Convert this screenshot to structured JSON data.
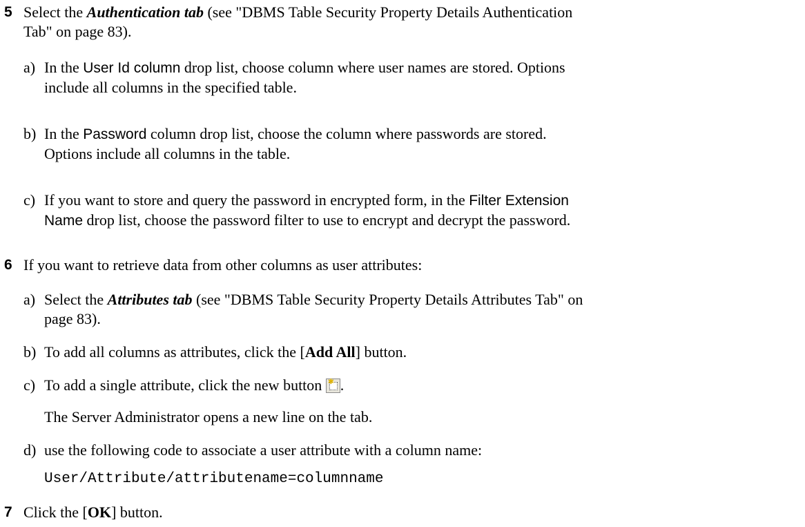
{
  "step5": {
    "number": "5",
    "intro_pre": "Select the ",
    "intro_tab": "Authentication tab",
    "intro_post1": " (see \"DBMS Table Security Property Details Authentication",
    "intro_post2": "Tab\" on page 83).",
    "a_letter": "a)",
    "a_pre": "In the ",
    "a_ui": "User Id column",
    "a_post1": " drop list, choose column where user names are stored.  Options",
    "a_post2": "include all columns in the specified table.",
    "b_letter": "b)",
    "b_pre": "In the ",
    "b_ui": "Password",
    "b_post1": " column drop list, choose the column where passwords are stored.",
    "b_post2": "Options include all columns in the table.",
    "c_letter": "c)",
    "c_line1": "If you want to store and query the password in encrypted form, in the ",
    "c_ui1": "Filter Extension",
    "c_ui2": "Name",
    "c_line2": " drop list, choose the password filter to use to encrypt and decrypt the password."
  },
  "step6": {
    "number": "6",
    "intro": "If you want to retrieve data from other columns as user attributes:",
    "a_letter": "a)",
    "a_pre": "Select the ",
    "a_tab": "Attributes tab",
    "a_post1": " (see \"DBMS Table Security Property Details Attributes Tab\" on",
    "a_post2": "page 83).",
    "b_letter": "b)",
    "b_pre": "To add all columns as attributes, click the [",
    "b_btn": "Add All",
    "b_post": "] button.",
    "c_letter": "c)",
    "c_pre": "To add  a single attribute, click the new button ",
    "c_post": ".",
    "c_note": "The Server Administrator opens a new line on the tab.",
    "d_letter": "d)",
    "d_text": "use the following code to associate a user attribute with a column name:",
    "d_code": "User/Attribute/attributename=columnname"
  },
  "step7": {
    "number": "7",
    "pre": "Click the [",
    "btn": "OK",
    "post": "] button."
  },
  "icons": {
    "new_button": "new-item-icon"
  }
}
